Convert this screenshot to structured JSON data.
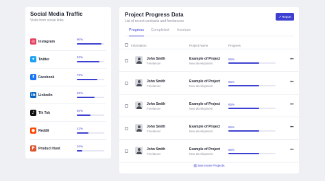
{
  "social": {
    "title": "Social Media Traffic",
    "subtitle": "Visits from social links",
    "items": [
      {
        "name": "Instagram",
        "percent": "90%",
        "value": 0.9,
        "icon": "instagram-icon",
        "color": "#e4405f",
        "glyph": "◎"
      },
      {
        "name": "Twitter",
        "percent": "82%",
        "value": 0.82,
        "icon": "twitter-icon",
        "color": "#1da1f2",
        "glyph": "✦"
      },
      {
        "name": "Facebook",
        "percent": "75%",
        "value": 0.75,
        "icon": "facebook-icon",
        "color": "#1877f2",
        "glyph": "f"
      },
      {
        "name": "Linkedin",
        "percent": "65%",
        "value": 0.65,
        "icon": "linkedin-icon",
        "color": "#0a66c2",
        "glyph": "in"
      },
      {
        "name": "Tik Tok",
        "percent": "50%",
        "value": 0.5,
        "icon": "tiktok-icon",
        "color": "#111111",
        "glyph": "♪"
      },
      {
        "name": "Reddit",
        "percent": "42%",
        "value": 0.42,
        "icon": "reddit-icon",
        "color": "#ff4500",
        "glyph": "●"
      },
      {
        "name": "Product Hunt",
        "percent": "20%",
        "value": 0.2,
        "icon": "producthunt-icon",
        "color": "#da552f",
        "glyph": "P"
      }
    ]
  },
  "projects": {
    "title": "Project Progress Data",
    "subtitle": "List of recent contracts and freelancers",
    "report_label": "Report",
    "tabs": [
      "Progress",
      "Completed",
      "Invoices"
    ],
    "columns": {
      "information": "Information",
      "project_name": "Project Name",
      "progress": "Progress"
    },
    "rows": [
      {
        "name": "John Smith",
        "role": "Freelancer",
        "project": "Example of Project",
        "desc": "New development",
        "percent": "65%",
        "value": 0.65
      },
      {
        "name": "John Smith",
        "role": "Freelancer",
        "project": "Example of Project",
        "desc": "New development",
        "percent": "65%",
        "value": 0.65
      },
      {
        "name": "John Smith",
        "role": "Freelancer",
        "project": "Example of Project",
        "desc": "New development",
        "percent": "65%",
        "value": 0.65
      },
      {
        "name": "John Smith",
        "role": "Freelancer",
        "project": "Example of Project",
        "desc": "New development",
        "percent": "65%",
        "value": 0.65
      },
      {
        "name": "John Smith",
        "role": "Freelancer",
        "project": "Example of Project",
        "desc": "New development",
        "percent": "65%",
        "value": 0.65
      }
    ],
    "see_more_label": "See more Projects"
  },
  "colors": {
    "accent": "#3c3fd0",
    "track": "#e6e7f4"
  }
}
